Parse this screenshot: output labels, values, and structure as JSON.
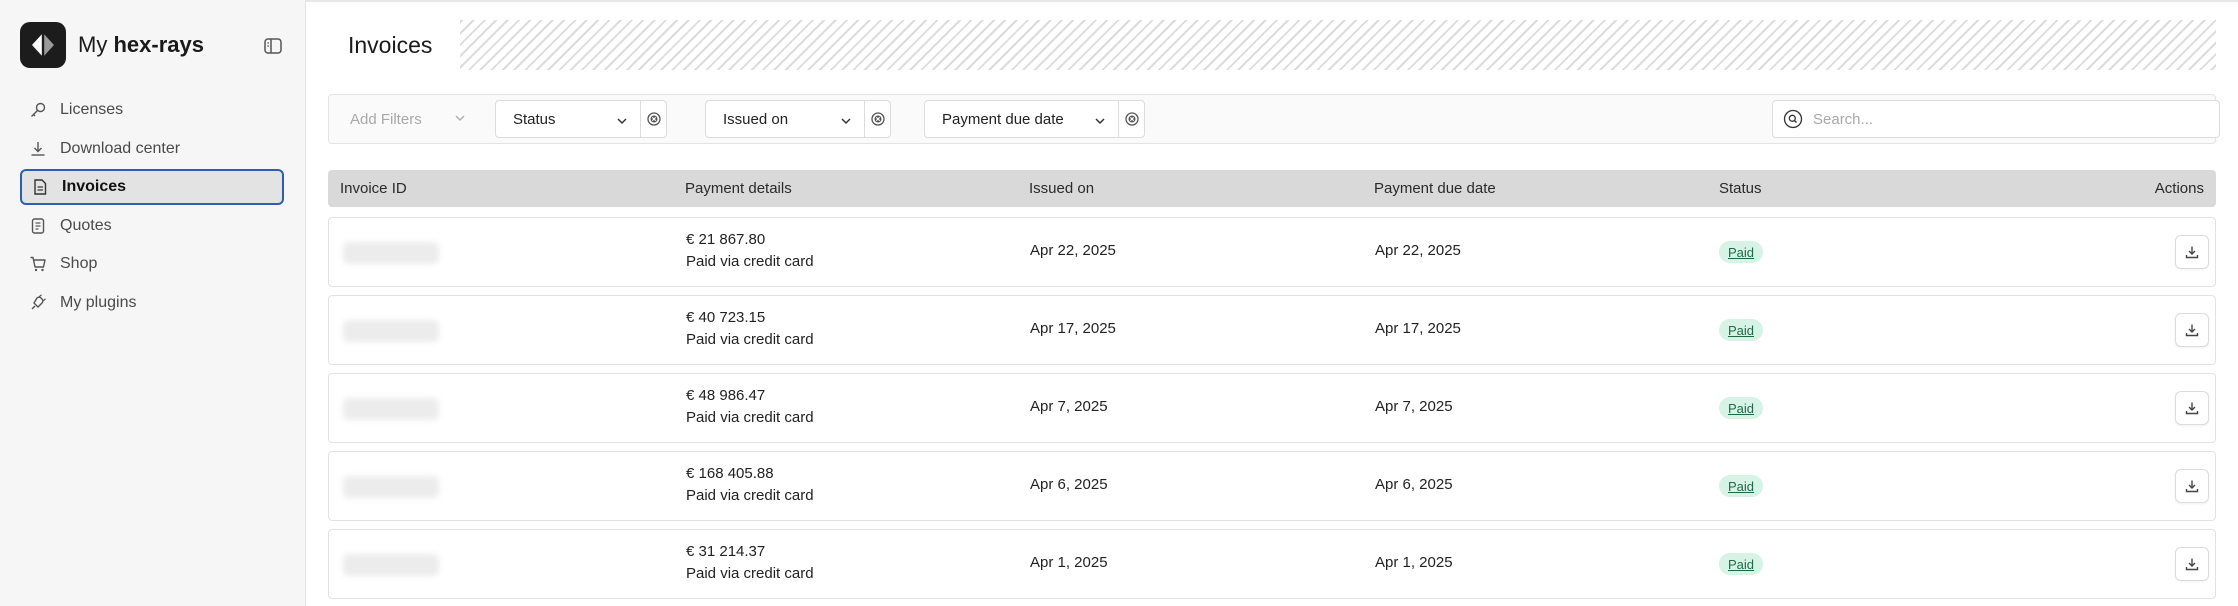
{
  "sidebar": {
    "brand": {
      "prefix": "My",
      "name": "hex-rays"
    },
    "items": [
      {
        "label": "Licenses",
        "icon": "key-icon",
        "active": false
      },
      {
        "label": "Download center",
        "icon": "download-icon",
        "active": false
      },
      {
        "label": "Invoices",
        "icon": "document-icon",
        "active": true
      },
      {
        "label": "Quotes",
        "icon": "quote-doc-icon",
        "active": false
      },
      {
        "label": "Shop",
        "icon": "cart-icon",
        "active": false
      },
      {
        "label": "My plugins",
        "icon": "plugin-icon",
        "active": false
      }
    ]
  },
  "header": {
    "title": "Invoices"
  },
  "filters": {
    "add_filters": "Add Filters",
    "status": "Status",
    "issued_on": "Issued on",
    "payment_due_date": "Payment due date",
    "search_placeholder": "Search..."
  },
  "table": {
    "columns": [
      "Invoice ID",
      "Payment details",
      "Issued on",
      "Payment due date",
      "Status",
      "Actions"
    ],
    "rows": [
      {
        "amount": "€ 21 867.80",
        "method": "Paid via credit card",
        "issued": "Apr 22, 2025",
        "due": "Apr 22, 2025",
        "status": "Paid"
      },
      {
        "amount": "€ 40 723.15",
        "method": "Paid via credit card",
        "issued": "Apr 17, 2025",
        "due": "Apr 17, 2025",
        "status": "Paid"
      },
      {
        "amount": "€ 48 986.47",
        "method": "Paid via credit card",
        "issued": "Apr 7, 2025",
        "due": "Apr 7, 2025",
        "status": "Paid"
      },
      {
        "amount": "€ 168 405.88",
        "method": "Paid via credit card",
        "issued": "Apr 6, 2025",
        "due": "Apr 6, 2025",
        "status": "Paid"
      },
      {
        "amount": "€ 31 214.37",
        "method": "Paid via credit card",
        "issued": "Apr 1, 2025",
        "due": "Apr 1, 2025",
        "status": "Paid"
      }
    ]
  },
  "colors": {
    "accent_border": "#2d5fb0",
    "badge_bg": "#d6f3e6",
    "badge_text": "#1e6a47",
    "header_bg": "#d9d9d9"
  }
}
